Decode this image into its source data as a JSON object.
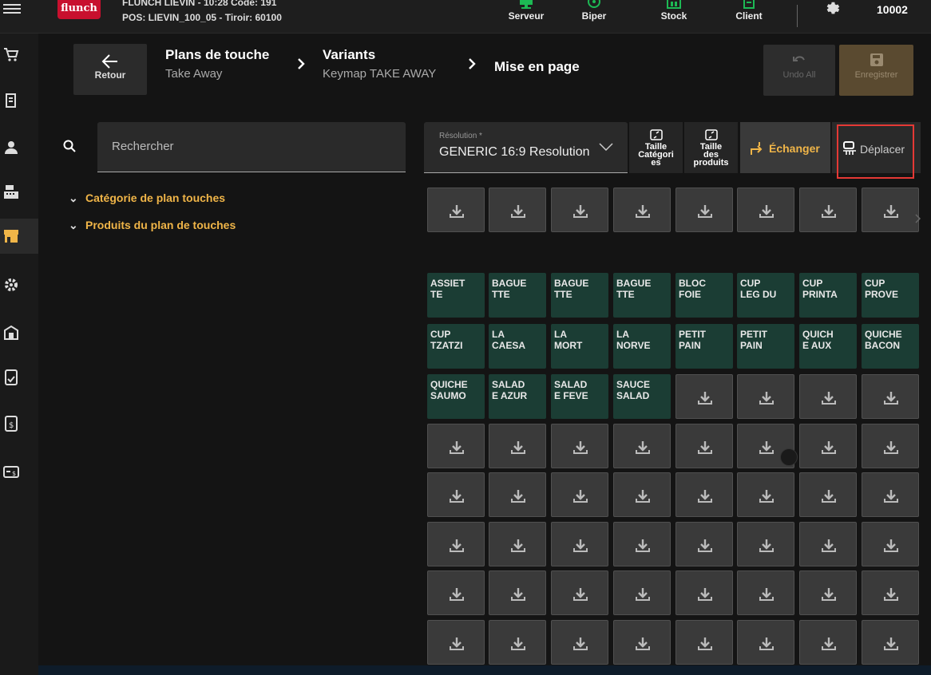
{
  "header": {
    "logo": "flunch",
    "store_line": "FLUNCH LIEVIN - 10:28  Code: 191",
    "pos_line": "POS: LIEVIN_100_05 - Tiroir: 60100",
    "actions": [
      {
        "label": "Serveur",
        "icon": "monitor-icon"
      },
      {
        "label": "Biper",
        "icon": "pager-icon"
      },
      {
        "label": "Stock",
        "icon": "warehouse-icon"
      },
      {
        "label": "Client",
        "icon": "client-card-icon"
      }
    ],
    "user_id": "10002",
    "accent_color": "#1db954"
  },
  "sidebar": {
    "items": [
      "cart-icon",
      "receipt-icon",
      "user-icon",
      "cash-register-icon",
      "store-icon",
      "gear-icon",
      "building-icon",
      "report-icon",
      "invoice-icon",
      "payment-card-icon"
    ],
    "active_index": 4,
    "active_color": "#f0b548"
  },
  "nav": {
    "back_label": "Retour",
    "breadcrumb": [
      {
        "title": "Plans de touche",
        "subtitle": "Take Away"
      },
      {
        "title": "Variants",
        "subtitle": "Keymap TAKE AWAY"
      },
      {
        "title": "Mise en page",
        "subtitle": ""
      }
    ],
    "undo_label": "Undo All",
    "save_label": "Enregistrer"
  },
  "search": {
    "placeholder": "Rechercher"
  },
  "tree": [
    {
      "label": "Catégorie de plan touches"
    },
    {
      "label": "Produits du plan de touches"
    }
  ],
  "toolbar": {
    "resolution_label": "Résolution *",
    "resolution_value": "GENERIC 16:9 Resolution",
    "category_size_label": [
      "Taille",
      "Catégori",
      "es"
    ],
    "product_size_label": [
      "Taille",
      "des",
      "produits"
    ],
    "swap_label": "Échanger",
    "move_label": "Déplacer",
    "swap_color": "#f0b548",
    "highlight_color": "#e53935"
  },
  "categories_row": 8,
  "products": [
    [
      "ASSIET",
      "TE"
    ],
    [
      "BAGUE",
      "TTE"
    ],
    [
      "BAGUE",
      "TTE"
    ],
    [
      "BAGUE",
      "TTE"
    ],
    [
      "BLOC",
      "FOIE"
    ],
    [
      "CUP",
      "LEG DU"
    ],
    [
      "CUP",
      "PRINTA"
    ],
    [
      "CUP",
      "PROVE"
    ],
    [
      "CUP",
      "TZATZI"
    ],
    [
      "LA",
      "CAESA"
    ],
    [
      "LA",
      "MORT"
    ],
    [
      "LA",
      "NORVE"
    ],
    [
      "PETIT",
      "PAIN"
    ],
    [
      "PETIT",
      "PAIN"
    ],
    [
      "QUICH",
      "E AUX"
    ],
    [
      "QUICHE",
      "BACON"
    ],
    [
      "QUICHE",
      "SAUMO"
    ],
    [
      "SALAD",
      "E AZUR"
    ],
    [
      "SALAD",
      "E FEVE"
    ],
    [
      "SAUCE",
      "SALAD"
    ]
  ],
  "product_color": "#1b3d34",
  "product_rows": 8,
  "grid_columns": 8
}
